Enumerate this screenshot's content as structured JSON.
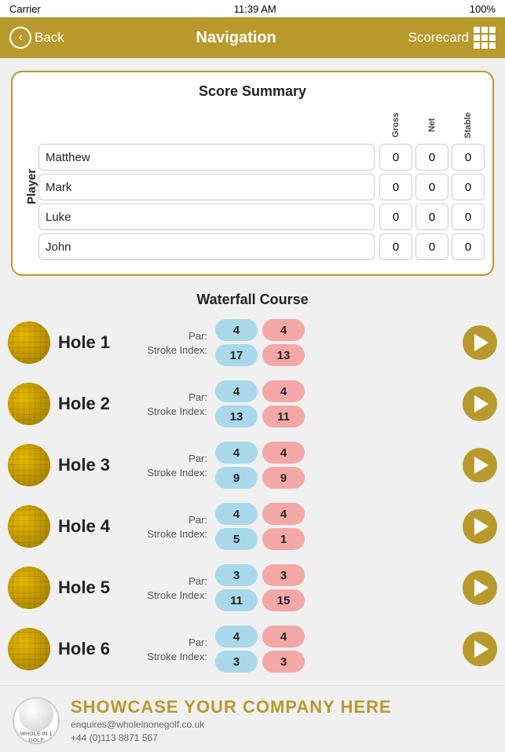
{
  "statusBar": {
    "carrier": "Carrier",
    "wifi": "✦",
    "time": "11:39 AM",
    "battery": "100%"
  },
  "header": {
    "back_label": "Back",
    "title": "Navigation",
    "scorecard_label": "Scorecard"
  },
  "scoreSummary": {
    "title": "Score Summary",
    "player_label": "Player",
    "col_headers": [
      "Gross",
      "Net",
      "Stable"
    ],
    "players": [
      {
        "name": "Matthew",
        "gross": "0",
        "net": "0",
        "stable": "0"
      },
      {
        "name": "Mark",
        "gross": "0",
        "net": "0",
        "stable": "0"
      },
      {
        "name": "Luke",
        "gross": "0",
        "net": "0",
        "stable": "0"
      },
      {
        "name": "John",
        "gross": "0",
        "net": "0",
        "stable": "0"
      }
    ]
  },
  "courseName": "Waterfall Course",
  "holes": [
    {
      "name": "Hole 1",
      "par_blue": "4",
      "par_pink": "4",
      "si_blue": "17",
      "si_pink": "13"
    },
    {
      "name": "Hole 2",
      "par_blue": "4",
      "par_pink": "4",
      "si_blue": "13",
      "si_pink": "11"
    },
    {
      "name": "Hole 3",
      "par_blue": "4",
      "par_pink": "4",
      "si_blue": "9",
      "si_pink": "9"
    },
    {
      "name": "Hole 4",
      "par_blue": "4",
      "par_pink": "4",
      "si_blue": "5",
      "si_pink": "1"
    },
    {
      "name": "Hole 5",
      "par_blue": "3",
      "par_pink": "3",
      "si_blue": "11",
      "si_pink": "15"
    },
    {
      "name": "Hole 6",
      "par_blue": "4",
      "par_pink": "4",
      "si_blue": "3",
      "si_pink": "3"
    }
  ],
  "labels": {
    "par": "Par:",
    "stroke_index": "Stroke Index:"
  },
  "footer": {
    "showcase": "SHOWCASE YOUR COMPANY HERE",
    "email": "enquires@wholeinonegolf.co.uk",
    "phone": "+44 (0)113 8871 567",
    "logo_label": "WHOLE IN 1\nGOLF"
  }
}
